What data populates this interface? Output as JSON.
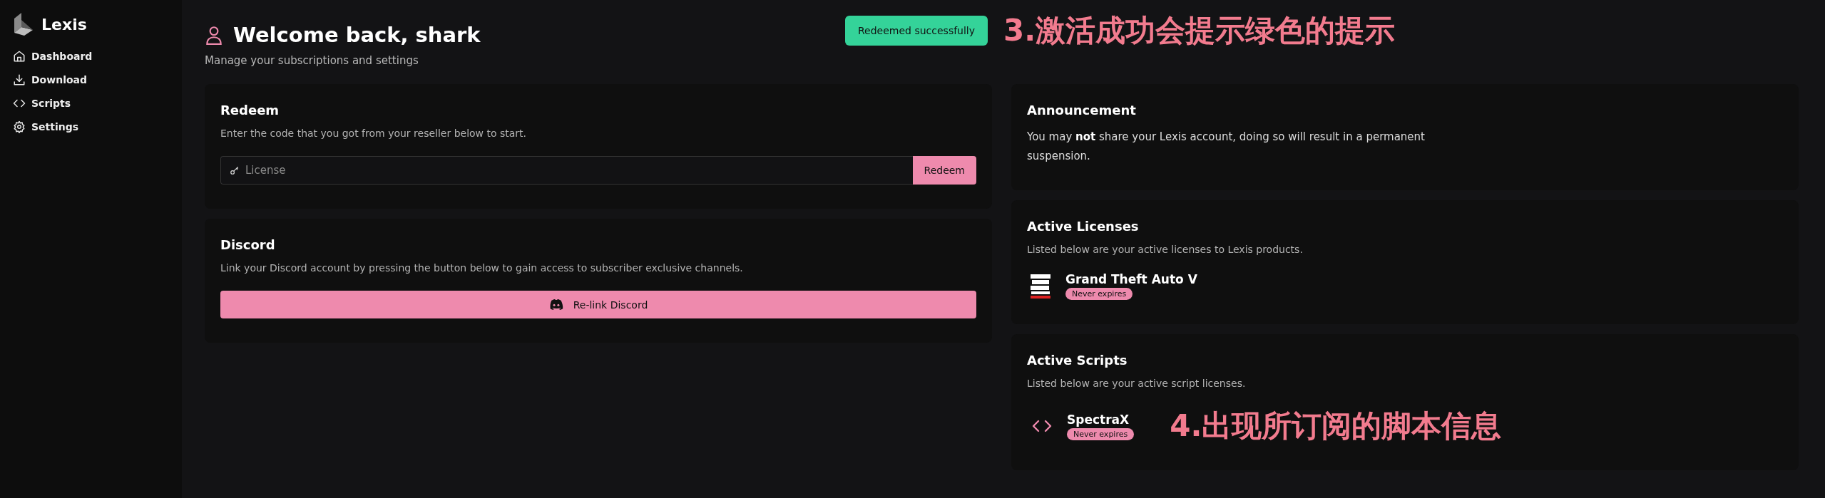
{
  "sidebar": {
    "brand": "Lexis",
    "items": [
      {
        "label": "Dashboard"
      },
      {
        "label": "Download"
      },
      {
        "label": "Scripts"
      },
      {
        "label": "Settings"
      }
    ]
  },
  "header": {
    "title": "Welcome back, shark",
    "subtitle": "Manage your subscriptions and settings"
  },
  "toast": {
    "text": "Redeemed successfully"
  },
  "annotations": [
    "3.激活成功会提示绿色的提示",
    "4.出现所订阅的脚本信息"
  ],
  "redeem": {
    "title": "Redeem",
    "description": "Enter the code that you got from your reseller below to start.",
    "placeholder": "License",
    "button": "Redeem"
  },
  "discord": {
    "title": "Discord",
    "description": "Link your Discord account by pressing the button below to gain access to subscriber exclusive channels.",
    "button": "Re-link Discord"
  },
  "announcement": {
    "title": "Announcement",
    "text": "You may **not** share your Lexis account, doing so will result in a permanent suspension."
  },
  "licenses": {
    "title": "Active Licenses",
    "description": "Listed below are your active licenses to Lexis products.",
    "items": [
      {
        "name": "Grand Theft Auto V",
        "badge": "Never expires"
      }
    ]
  },
  "scripts": {
    "title": "Active Scripts",
    "description": "Listed below are your active script licenses.",
    "items": [
      {
        "name": "SpectraX",
        "badge": "Never expires"
      }
    ]
  }
}
